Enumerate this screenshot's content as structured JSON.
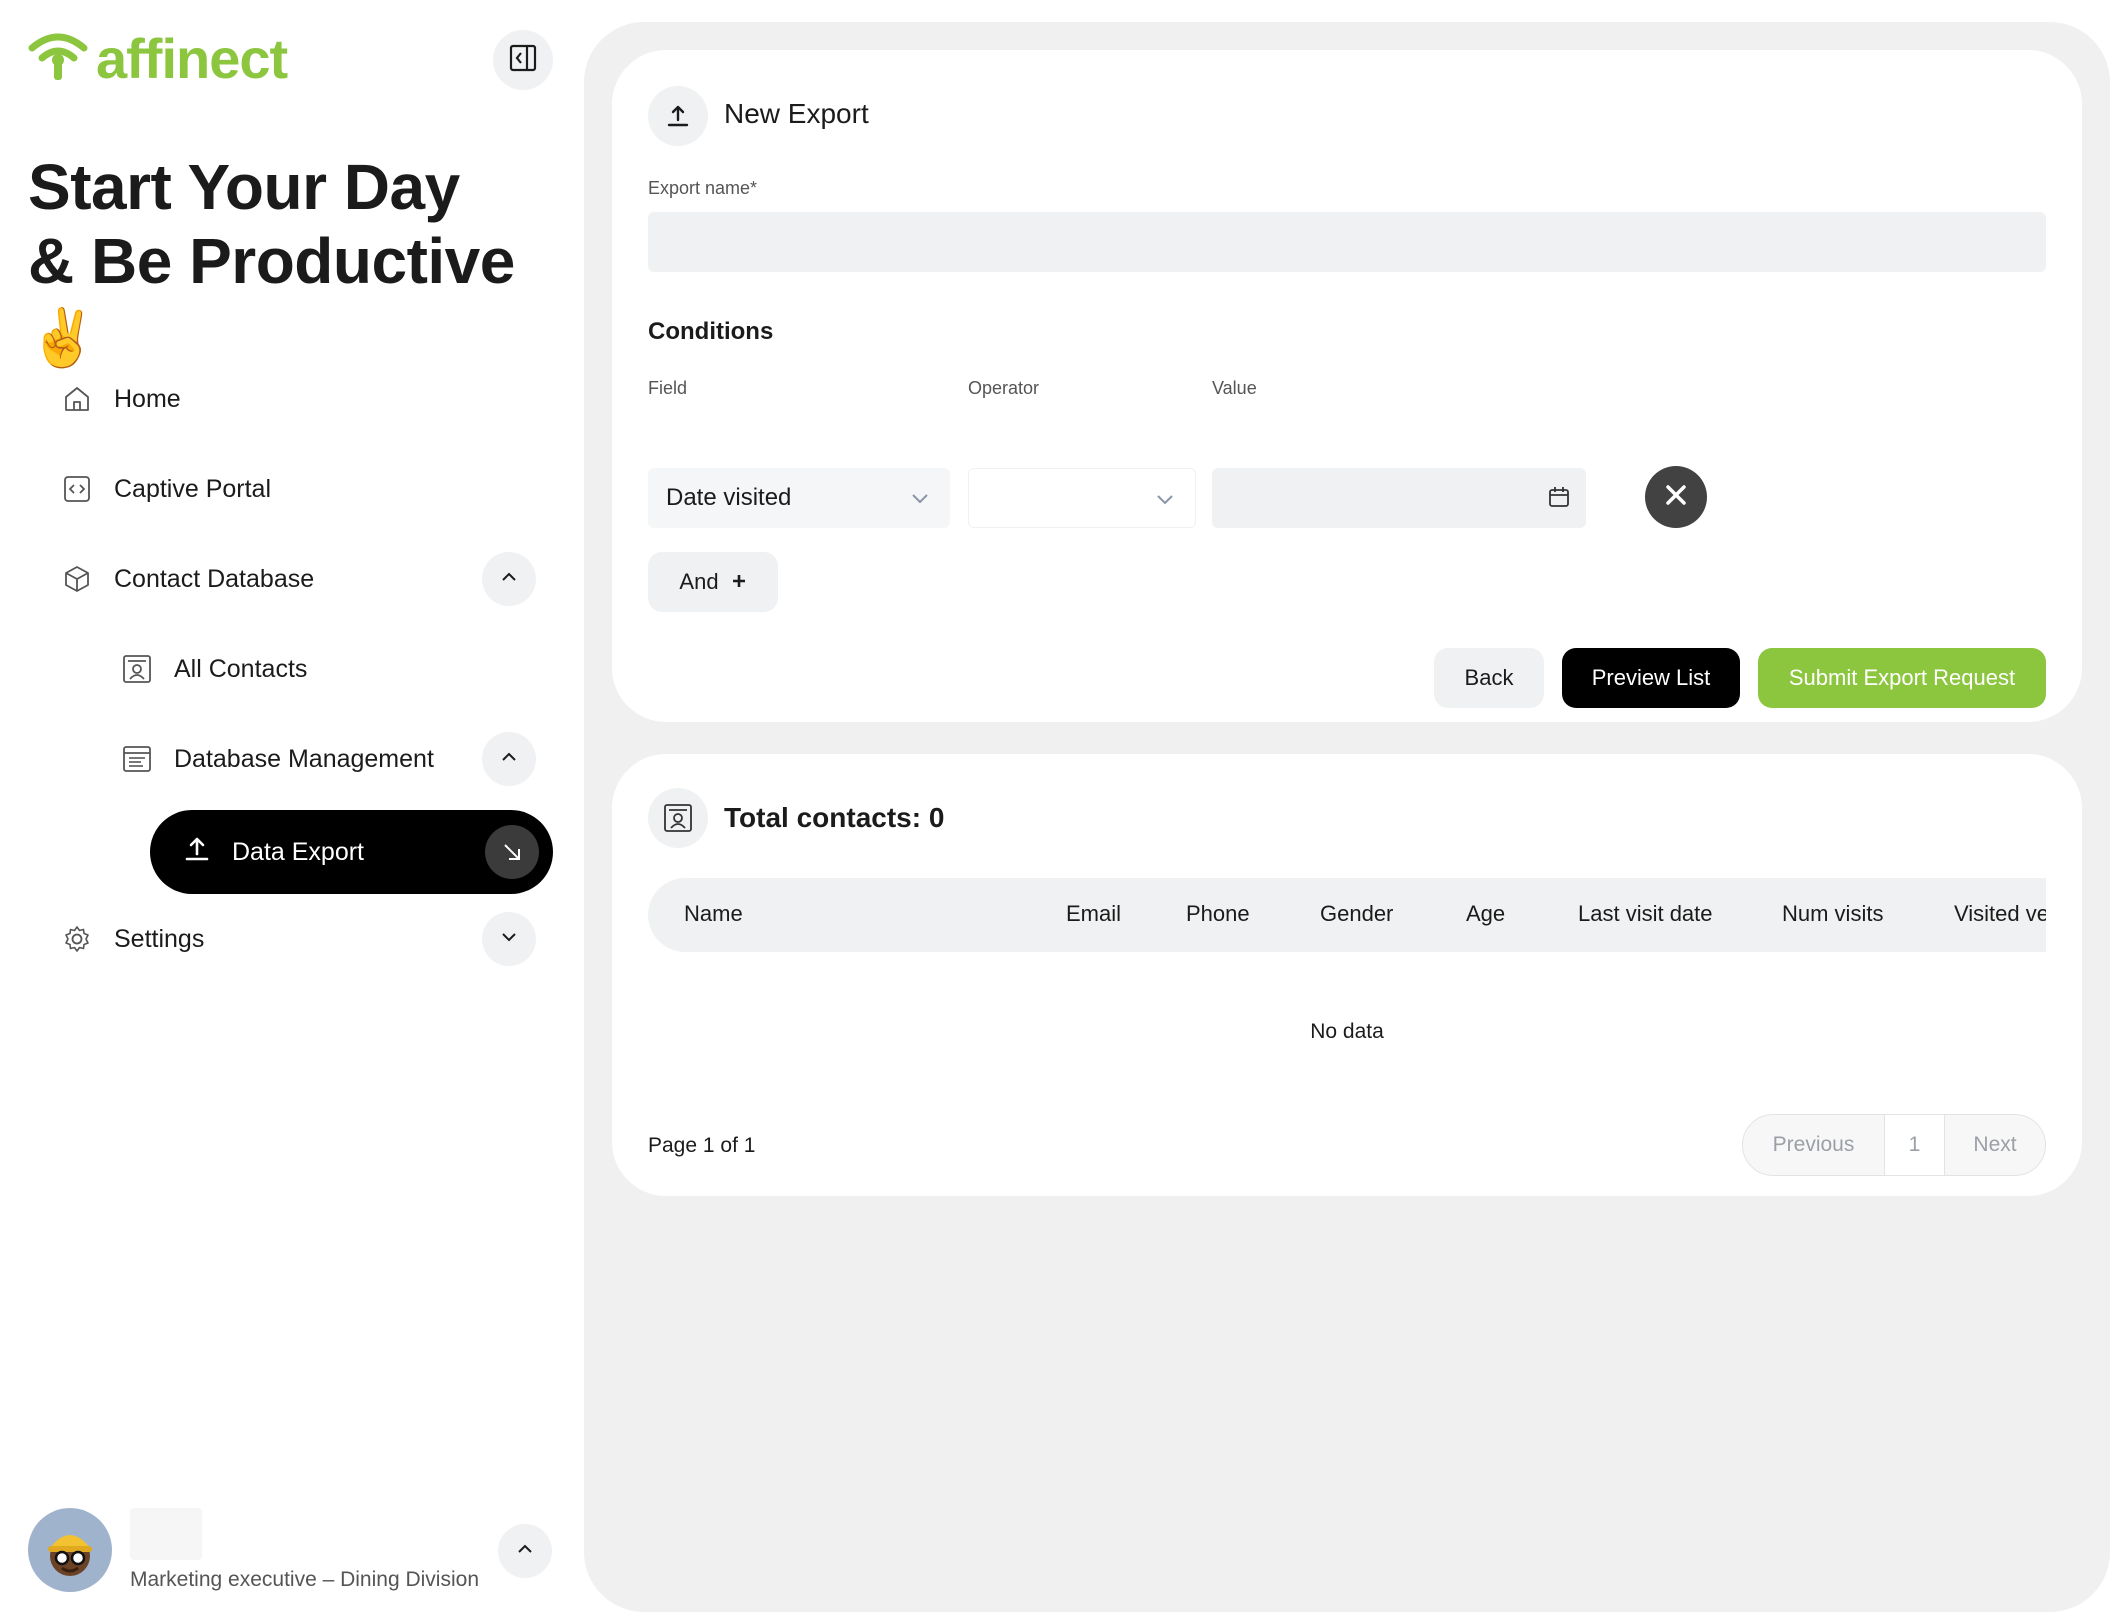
{
  "sidebar": {
    "logo_text": "affinect",
    "greeting_line1": "Start Your Day",
    "greeting_line2": "& Be Productive",
    "greeting_emoji": "✌️",
    "nav": {
      "home": "Home",
      "captive_portal": "Captive Portal",
      "contact_database": "Contact Database",
      "all_contacts": "All Contacts",
      "database_management": "Database Management",
      "data_export": "Data Export",
      "settings": "Settings"
    },
    "profile": {
      "role": "Marketing executive – Dining Division"
    }
  },
  "export_card": {
    "title": "New Export",
    "export_name_label": "Export name*",
    "export_name_value": "",
    "conditions_title": "Conditions",
    "field_label": "Field",
    "operator_label": "Operator",
    "value_label": "Value",
    "field_value": "Date visited",
    "operator_value": "",
    "value_value": "",
    "and_label": "And",
    "back_label": "Back",
    "preview_label": "Preview List",
    "submit_label": "Submit Export Request"
  },
  "contacts_card": {
    "title": "Total contacts: 0",
    "columns": [
      "Name",
      "Email",
      "Phone",
      "Gender",
      "Age",
      "Last visit date",
      "Num visits",
      "Visited ve"
    ],
    "empty_text": "No data",
    "page_info": "Page 1 of 1",
    "pager": {
      "previous": "Previous",
      "current": "1",
      "next": "Next"
    }
  },
  "colors": {
    "brand_green": "#8cc63f",
    "active_nav_bg": "#000000",
    "main_bg": "#f0f0f0"
  },
  "icons": [
    "wifi-logo-icon",
    "collapse-sidebar-icon",
    "home-icon",
    "code-icon",
    "box-icon",
    "contact-card-icon",
    "list-icon",
    "upload-icon",
    "arrow-down-right-icon",
    "gear-icon",
    "chevron-up-icon",
    "chevron-down-icon",
    "calendar-icon",
    "close-icon",
    "plus-icon"
  ]
}
